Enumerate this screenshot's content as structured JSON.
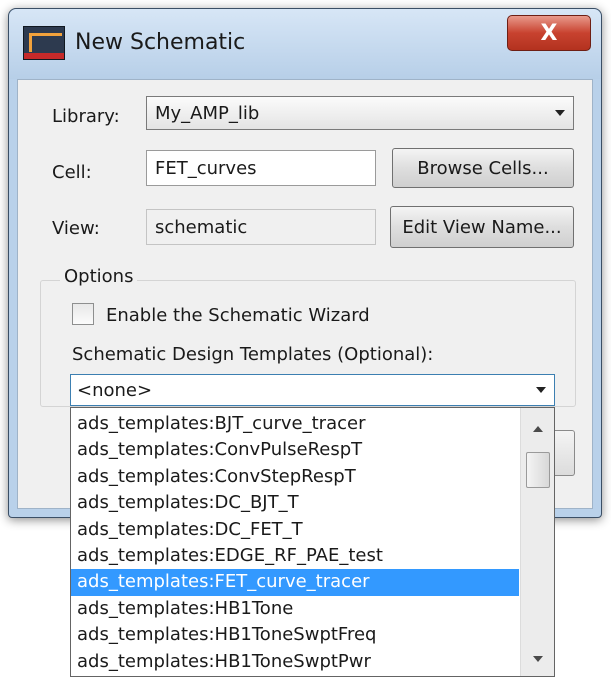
{
  "window": {
    "title": "New Schematic",
    "close_label": "X",
    "app_icon": "ads-app-icon"
  },
  "form": {
    "library_label": "Library:",
    "library_value": "My_AMP_lib",
    "cell_label": "Cell:",
    "cell_value": "FET_curves",
    "browse_cells_label": "Browse Cells...",
    "view_label": "View:",
    "view_value": "schematic",
    "edit_view_name_label": "Edit View Name..."
  },
  "options": {
    "group_label": "Options",
    "wizard_checkbox_label": "Enable the Schematic Wizard",
    "wizard_checked": false,
    "templates_label": "Schematic Design Templates (Optional):",
    "templates_selected": "<none>",
    "templates_list": [
      "ads_templates:BJT_curve_tracer",
      "ads_templates:ConvPulseRespT",
      "ads_templates:ConvStepRespT",
      "ads_templates:DC_BJT_T",
      "ads_templates:DC_FET_T",
      "ads_templates:EDGE_RF_PAE_test",
      "ads_templates:FET_curve_tracer",
      "ads_templates:HB1Tone",
      "ads_templates:HB1ToneSwptFreq",
      "ads_templates:HB1ToneSwptPwr"
    ],
    "highlighted_index": 6
  },
  "colors": {
    "highlight": "#3399ff",
    "frame": "#b9d1ea",
    "close_button": "#c8422f"
  }
}
